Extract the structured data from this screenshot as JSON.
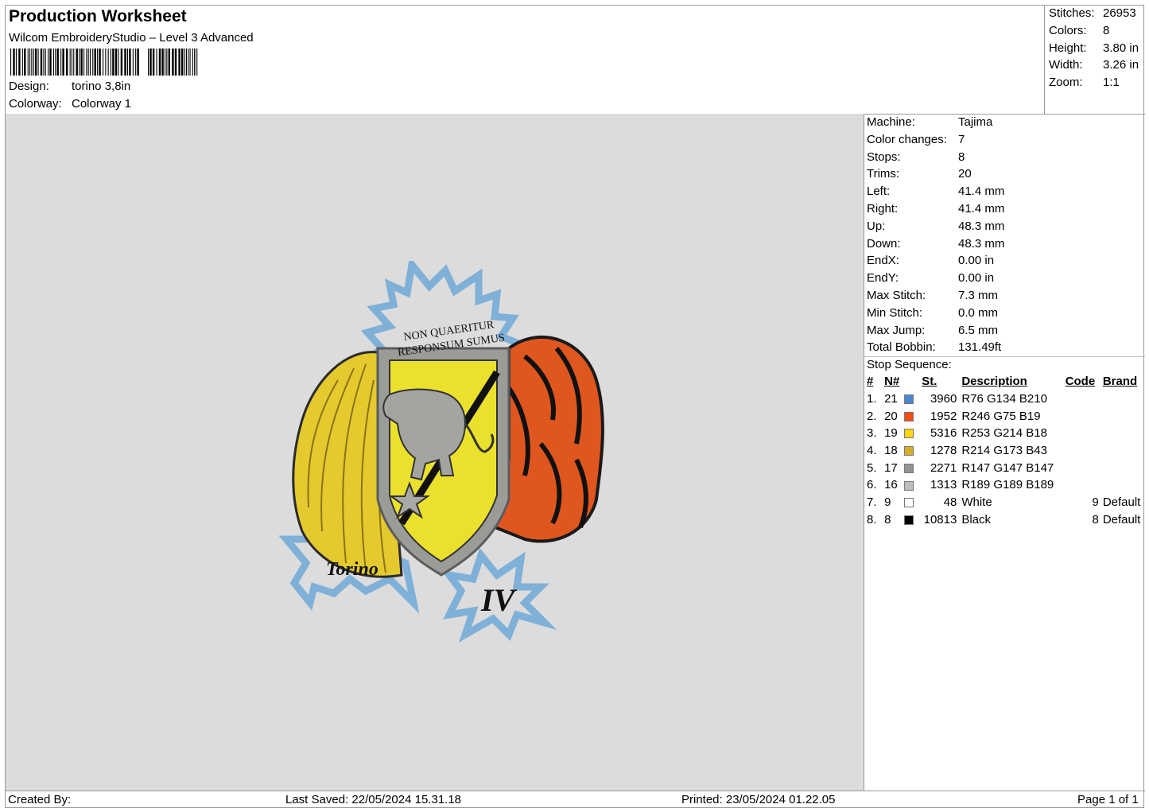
{
  "header": {
    "title": "Production Worksheet",
    "software": "Wilcom EmbroideryStudio – Level 3 Advanced",
    "design_label": "Design:",
    "design_value": "torino 3,8in",
    "colorway_label": "Colorway:",
    "colorway_value": "Colorway 1"
  },
  "summary": {
    "stitches_label": "Stitches:",
    "stitches": "26953",
    "colors_label": "Colors:",
    "colors": "8",
    "height_label": "Height:",
    "height": "3.80 in",
    "width_label": "Width:",
    "width": "3.26 in",
    "zoom_label": "Zoom:",
    "zoom": "1:1"
  },
  "details": [
    {
      "label": "Machine:",
      "value": "Tajima"
    },
    {
      "label": "Color changes:",
      "value": "7"
    },
    {
      "label": "Stops:",
      "value": "8"
    },
    {
      "label": "Trims:",
      "value": "20"
    },
    {
      "label": "Left:",
      "value": "41.4 mm"
    },
    {
      "label": "Right:",
      "value": "41.4 mm"
    },
    {
      "label": "Up:",
      "value": "48.3 mm"
    },
    {
      "label": "Down:",
      "value": "48.3 mm"
    },
    {
      "label": "EndX:",
      "value": "0.00 in"
    },
    {
      "label": "EndY:",
      "value": "0.00 in"
    },
    {
      "label": "Max Stitch:",
      "value": "7.3 mm"
    },
    {
      "label": "Min Stitch:",
      "value": "0.0 mm"
    },
    {
      "label": "Max Jump:",
      "value": "6.5 mm"
    },
    {
      "label": "Total Bobbin:",
      "value": "131.49ft"
    }
  ],
  "stop_sequence": {
    "title": "Stop Sequence:",
    "headers": {
      "num": "#",
      "n": "N#",
      "st": "St.",
      "description": "Description",
      "code": "Code",
      "brand": "Brand"
    },
    "rows": [
      {
        "num": "1.",
        "n": "21",
        "color": "#4C86D2",
        "st": "3960",
        "description": "R76 G134 B210",
        "code": "",
        "brand": ""
      },
      {
        "num": "2.",
        "n": "20",
        "color": "#F64B13",
        "st": "1952",
        "description": "R246 G75 B19",
        "code": "",
        "brand": ""
      },
      {
        "num": "3.",
        "n": "19",
        "color": "#FDD612",
        "st": "5316",
        "description": "R253 G214 B18",
        "code": "",
        "brand": ""
      },
      {
        "num": "4.",
        "n": "18",
        "color": "#D6AD2B",
        "st": "1278",
        "description": "R214 G173 B43",
        "code": "",
        "brand": ""
      },
      {
        "num": "5.",
        "n": "17",
        "color": "#939393",
        "st": "2271",
        "description": "R147 G147 B147",
        "code": "",
        "brand": ""
      },
      {
        "num": "6.",
        "n": "16",
        "color": "#BDBDBD",
        "st": "1313",
        "description": "R189 G189 B189",
        "code": "",
        "brand": ""
      },
      {
        "num": "7.",
        "n": "9",
        "color": "#FFFFFF",
        "st": "48",
        "description": "White",
        "code": "9",
        "brand": "Default"
      },
      {
        "num": "8.",
        "n": "8",
        "color": "#000000",
        "st": "10813",
        "description": "Black",
        "code": "8",
        "brand": "Default"
      }
    ]
  },
  "design_art": {
    "motto_line1": "NON QUAERITUR",
    "motto_line2": "RESPONSUM SUMUS",
    "left_text": "Torino",
    "right_text": "IV"
  },
  "footer": {
    "created_by": "Created By:",
    "last_saved": "Last Saved: 22/05/2024 15.31.18",
    "printed": "Printed: 23/05/2024 01.22.05",
    "page": "Page 1 of 1"
  }
}
